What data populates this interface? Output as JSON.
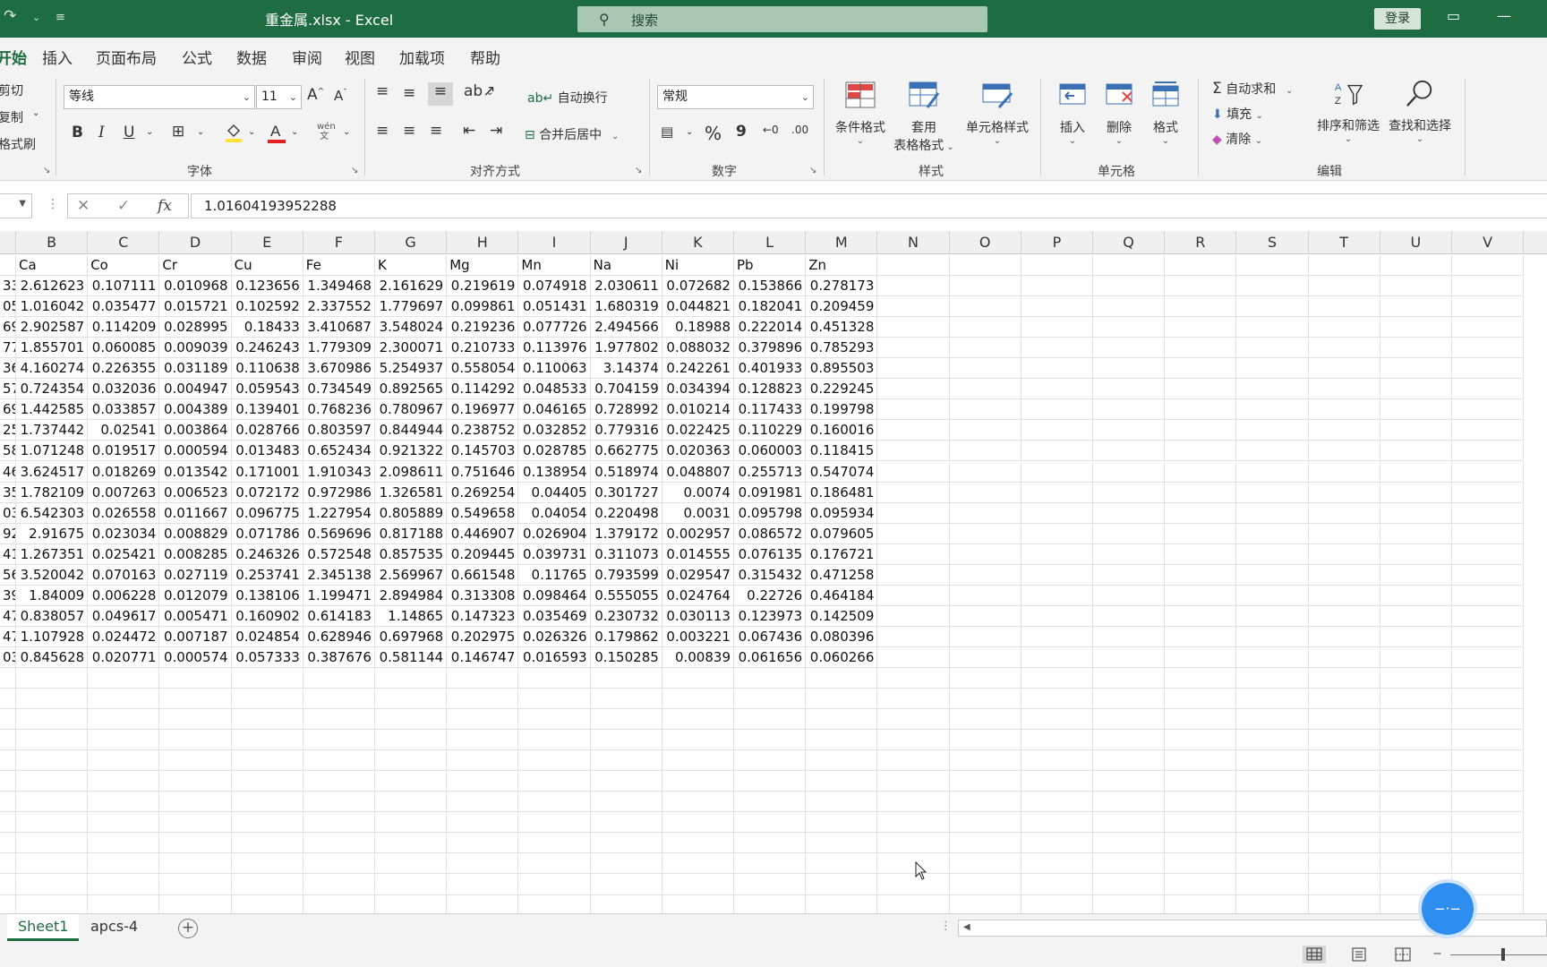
{
  "titlebar": {
    "title": "重金属.xlsx  -  Excel",
    "search_placeholder": "搜索",
    "login": "登录"
  },
  "tabs": [
    "开始",
    "插入",
    "页面布局",
    "公式",
    "数据",
    "审阅",
    "视图",
    "加载项",
    "帮助"
  ],
  "ribbon": {
    "clipboard": {
      "cut": "剪切",
      "copy": "复制",
      "format_painter": "格式刷"
    },
    "font": {
      "name": "等线",
      "size": "11",
      "label": "字体",
      "bold": "B",
      "italic": "I",
      "underline": "U",
      "phonetic": "wén"
    },
    "alignment": {
      "wrap": "自动换行",
      "merge": "合并后居中",
      "label": "对齐方式"
    },
    "number": {
      "format": "常规",
      "label": "数字",
      "percent": "%",
      "comma": "9"
    },
    "styles": {
      "conditional": "条件格式",
      "table_1": "套用",
      "table_2": "表格格式",
      "cell_styles": "单元格样式",
      "label": "样式"
    },
    "cells": {
      "insert": "插入",
      "delete": "删除",
      "format": "格式",
      "label": "单元格"
    },
    "editing": {
      "autosum": "自动求和",
      "fill": "填充",
      "clear": "清除",
      "sort": "排序和筛选",
      "find": "查找和选择",
      "label": "编辑"
    }
  },
  "formula_bar": {
    "value": "1.01604193952288",
    "fx": "fx"
  },
  "columns": [
    "B",
    "C",
    "D",
    "E",
    "F",
    "G",
    "H",
    "I",
    "J",
    "K",
    "L",
    "M",
    "N",
    "O",
    "P",
    "Q",
    "R",
    "S",
    "T",
    "U",
    "V"
  ],
  "sheet": {
    "headers": [
      "Ca",
      "Co",
      "Cr",
      "Cu",
      "Fe",
      "K",
      "Mg",
      "Mn",
      "Na",
      "Ni",
      "Pb",
      "Zn"
    ],
    "col_a_fragments": [
      "33",
      "05",
      "69",
      "77",
      "36",
      "57",
      "69",
      "25",
      "58",
      "46",
      "35",
      "03",
      "92",
      "41",
      "56",
      "39",
      "47",
      "47",
      "03"
    ],
    "rows": [
      [
        "2.612623",
        "0.107111",
        "0.010968",
        "0.123656",
        "1.349468",
        "2.161629",
        "0.219619",
        "0.074918",
        "2.030611",
        "0.072682",
        "0.153866",
        "0.278173"
      ],
      [
        "1.016042",
        "0.035477",
        "0.015721",
        "0.102592",
        "2.337552",
        "1.779697",
        "0.099861",
        "0.051431",
        "1.680319",
        "0.044821",
        "0.182041",
        "0.209459"
      ],
      [
        "2.902587",
        "0.114209",
        "0.028995",
        "0.18433",
        "3.410687",
        "3.548024",
        "0.219236",
        "0.077726",
        "2.494566",
        "0.18988",
        "0.222014",
        "0.451328"
      ],
      [
        "1.855701",
        "0.060085",
        "0.009039",
        "0.246243",
        "1.779309",
        "2.300071",
        "0.210733",
        "0.113976",
        "1.977802",
        "0.088032",
        "0.379896",
        "0.785293"
      ],
      [
        "4.160274",
        "0.226355",
        "0.031189",
        "0.110638",
        "3.670986",
        "5.254937",
        "0.558054",
        "0.110063",
        "3.14374",
        "0.242261",
        "0.401933",
        "0.895503"
      ],
      [
        "0.724354",
        "0.032036",
        "0.004947",
        "0.059543",
        "0.734549",
        "0.892565",
        "0.114292",
        "0.048533",
        "0.704159",
        "0.034394",
        "0.128823",
        "0.229245"
      ],
      [
        "1.442585",
        "0.033857",
        "0.004389",
        "0.139401",
        "0.768236",
        "0.780967",
        "0.196977",
        "0.046165",
        "0.728992",
        "0.010214",
        "0.117433",
        "0.199798"
      ],
      [
        "1.737442",
        "0.02541",
        "0.003864",
        "0.028766",
        "0.803597",
        "0.844944",
        "0.238752",
        "0.032852",
        "0.779316",
        "0.022425",
        "0.110229",
        "0.160016"
      ],
      [
        "1.071248",
        "0.019517",
        "0.000594",
        "0.013483",
        "0.652434",
        "0.921322",
        "0.145703",
        "0.028785",
        "0.662775",
        "0.020363",
        "0.060003",
        "0.118415"
      ],
      [
        "3.624517",
        "0.018269",
        "0.013542",
        "0.171001",
        "1.910343",
        "2.098611",
        "0.751646",
        "0.138954",
        "0.518974",
        "0.048807",
        "0.255713",
        "0.547074"
      ],
      [
        "1.782109",
        "0.007263",
        "0.006523",
        "0.072172",
        "0.972986",
        "1.326581",
        "0.269254",
        "0.04405",
        "0.301727",
        "0.0074",
        "0.091981",
        "0.186481"
      ],
      [
        "6.542303",
        "0.026558",
        "0.011667",
        "0.096775",
        "1.227954",
        "0.805889",
        "0.549658",
        "0.04054",
        "0.220498",
        "0.0031",
        "0.095798",
        "0.095934"
      ],
      [
        "2.91675",
        "0.023034",
        "0.008829",
        "0.071786",
        "0.569696",
        "0.817188",
        "0.446907",
        "0.026904",
        "1.379172",
        "0.002957",
        "0.086572",
        "0.079605"
      ],
      [
        "1.267351",
        "0.025421",
        "0.008285",
        "0.246326",
        "0.572548",
        "0.857535",
        "0.209445",
        "0.039731",
        "0.311073",
        "0.014555",
        "0.076135",
        "0.176721"
      ],
      [
        "3.520042",
        "0.070163",
        "0.027119",
        "0.253741",
        "2.345138",
        "2.569967",
        "0.661548",
        "0.11765",
        "0.793599",
        "0.029547",
        "0.315432",
        "0.471258"
      ],
      [
        "1.84009",
        "0.006228",
        "0.012079",
        "0.138106",
        "1.199471",
        "2.894984",
        "0.313308",
        "0.098464",
        "0.555055",
        "0.024764",
        "0.22726",
        "0.464184"
      ],
      [
        "0.838057",
        "0.049617",
        "0.005471",
        "0.160902",
        "0.614183",
        "1.14865",
        "0.147323",
        "0.035469",
        "0.230732",
        "0.030113",
        "0.123973",
        "0.142509"
      ],
      [
        "1.107928",
        "0.024472",
        "0.007187",
        "0.024854",
        "0.628946",
        "0.697968",
        "0.202975",
        "0.026326",
        "0.179862",
        "0.003221",
        "0.067436",
        "0.080396"
      ],
      [
        "0.845628",
        "0.020771",
        "0.000574",
        "0.057333",
        "0.387676",
        "0.581144",
        "0.146747",
        "0.016593",
        "0.150285",
        "0.00839",
        "0.061656",
        "0.060266"
      ]
    ]
  },
  "sheet_tabs": [
    "Sheet1",
    "apcs-4"
  ],
  "status": {
    "zoom_minus": "−"
  },
  "accent_color": "#1e6c41"
}
